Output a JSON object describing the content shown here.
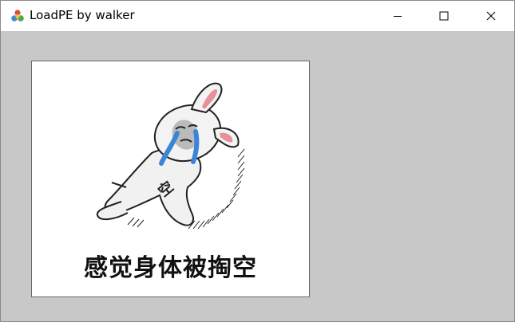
{
  "window": {
    "title": "LoadPE by walker",
    "app_icon": "loadpe-app-icon",
    "controls": {
      "minimize_icon": "minimize-icon",
      "maximize_icon": "maximize-icon",
      "close_icon": "close-icon"
    }
  },
  "content": {
    "image_icon": "crying-rabbit-meme",
    "image_caption": "感觉身体被掏空",
    "body_text": "空"
  },
  "colors": {
    "client_background": "#c8c8c8",
    "titlebar_background": "#ffffff",
    "tears": "#3a86d6",
    "ears": "#e7909a"
  }
}
